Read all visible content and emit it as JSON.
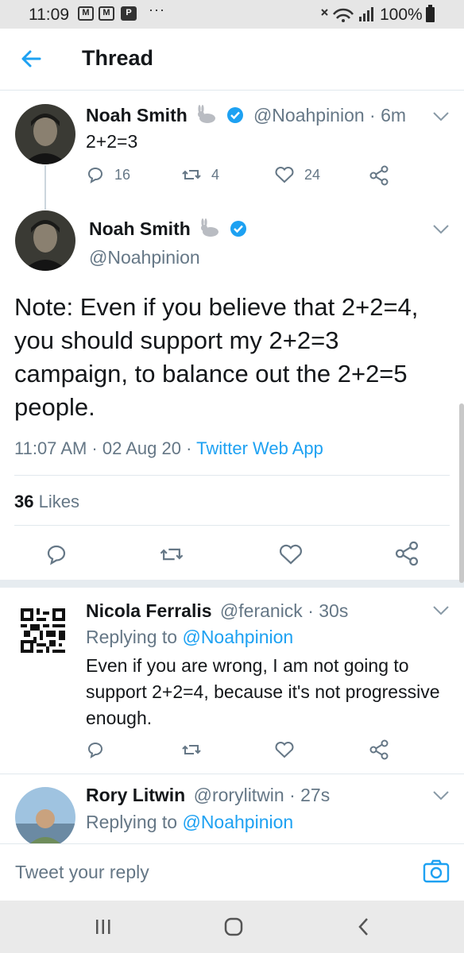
{
  "status_bar": {
    "time": "11:09",
    "notif_icons": [
      "mail-icon",
      "mail-icon",
      "p-icon"
    ],
    "p_letter": "P",
    "dots": "···",
    "battery_pct": "100%"
  },
  "header": {
    "title": "Thread",
    "back_icon": "arrow-left-icon",
    "accent_color": "#1da1f2"
  },
  "tweet1": {
    "name": "Noah Smith",
    "handle_time": "@Noahpinion · 6m",
    "text": "2+2=3",
    "replies": "16",
    "retweets": "4",
    "likes": "24"
  },
  "main_tweet": {
    "name": "Noah Smith",
    "handle": "@Noahpinion",
    "text": "Note: Even if you believe that 2+2=4, you should support my 2+2=3 campaign, to balance out the 2+2=5 people.",
    "time_date": "11:07 AM · 02 Aug 20 · ",
    "client": "Twitter Web App",
    "likes_count": "36",
    "likes_label": "Likes"
  },
  "reply1": {
    "name": "Nicola Ferralis",
    "handle_time": "@feranick · 30s",
    "replying_prefix": "Replying to ",
    "replying_to": "@Noahpinion",
    "text": "Even if you are wrong, I am not going to support 2+2=4, because it's not progressive enough."
  },
  "reply2": {
    "name": "Rory Litwin",
    "handle_time": "@rorylitwin · 27s",
    "replying_prefix": "Replying to ",
    "replying_to": "@Noahpinion"
  },
  "compose": {
    "placeholder": "Tweet your reply"
  }
}
